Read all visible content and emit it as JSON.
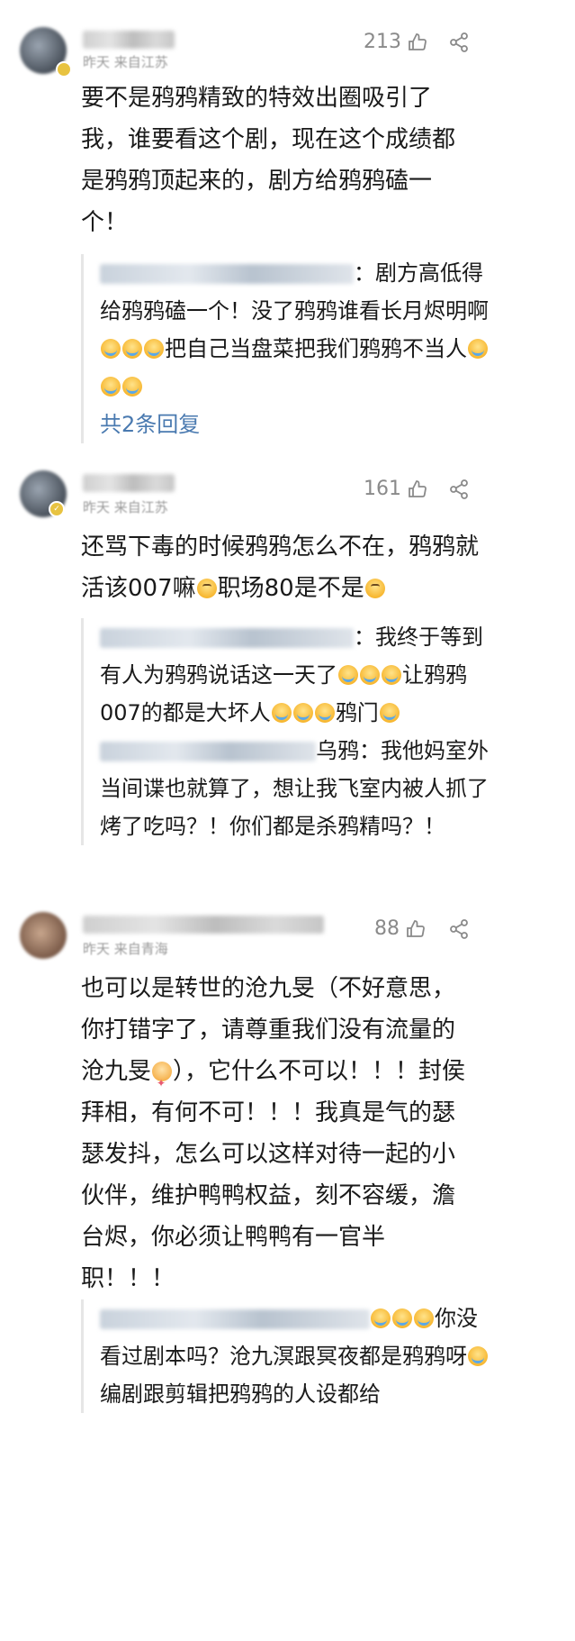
{
  "comments": [
    {
      "meta": "昨天  来自江苏",
      "likes": "213",
      "text": "要不是鸦鸦精致的特效出圈吸引了我，谁要看这个剧，现在这个成绩都是鸦鸦顶起来的，剧方给鸦鸦磕一个！",
      "reply": {
        "text_a": "：剧方高低得给鸦鸦磕一个！没了鸦鸦谁看长月烬明啊",
        "text_b": "把自己当盘菜把我们鸦鸦不当人",
        "more": "共2条回复"
      }
    },
    {
      "meta": "昨天  来自江苏",
      "likes": "161",
      "text_a": "还骂下毒的时候鸦鸦怎么不在，鸦鸦就活该007嘛",
      "text_b": "职场80是不是",
      "reply": {
        "line1": "：我终于等到有人为鸦鸦说话这一天了",
        "line1b": "让鸦鸦007的都是大坏人",
        "line1c": "鸦门",
        "line2": "乌鸦：我他妈室外当间谍也就算了，想让我飞室内被人抓了烤了吃吗？！你们都是杀鸦精吗？！"
      }
    },
    {
      "meta": "昨天  来自青海",
      "likes": "88",
      "text_a": "也可以是转世的沧九旻（不好意思，你打错字了，请尊重我们没有流量的沧九旻",
      "text_b": "），它什么不可以！！！封侯拜相，有何不可！！！我真是气的瑟瑟发抖，怎么可以这样对待一起的小伙伴，维护鸭鸭权益，刻不容缓，澹台烬，你必须让鸭鸭有一官半职！！！",
      "reply": {
        "text_a": "你没看过剧本吗？沧九溟跟冥夜都是鸦鸦呀",
        "text_b": "编剧跟剪辑把鸦鸦的人设都给"
      }
    }
  ],
  "icons": {
    "like": "thumb-up-icon",
    "share": "share-icon",
    "emoji_cry": "crying-face-icon",
    "emoji_roll": "eye-roll-face-icon",
    "emoji_hug": "hugging-face-icon"
  },
  "colors": {
    "link": "#4a7ab0",
    "meta": "#9a9a9a",
    "text": "#1a1a1a"
  }
}
